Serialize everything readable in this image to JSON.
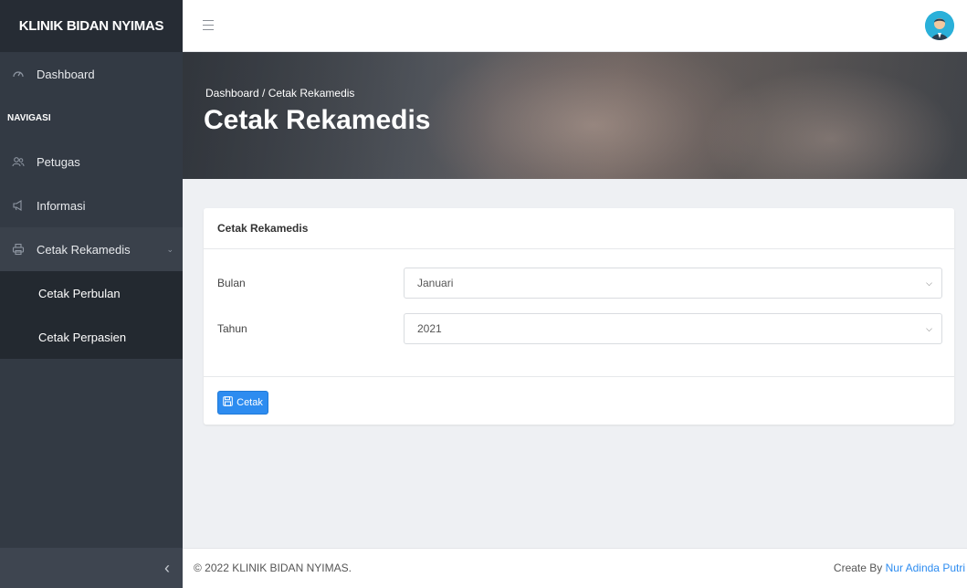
{
  "brand": "KLINIK BIDAN NYIMAS",
  "sidebar": {
    "items": [
      {
        "label": "Dashboard",
        "icon": "dashboard-icon"
      },
      {
        "section": "NAVIGASI"
      },
      {
        "label": "Petugas",
        "icon": "users-icon"
      },
      {
        "label": "Informasi",
        "icon": "megaphone-icon"
      },
      {
        "label": "Cetak Rekamedis",
        "icon": "printer-icon",
        "expanded": true
      }
    ],
    "subitems": [
      "Cetak Perbulan",
      "Cetak Perpasien"
    ]
  },
  "header": {
    "breadcrumb": "Dashboard / Cetak Rekamedis",
    "title": "Cetak Rekamedis"
  },
  "card": {
    "title": "Cetak Rekamedis",
    "fields": [
      {
        "label": "Bulan",
        "value": "Januari"
      },
      {
        "label": "Tahun",
        "value": "2021"
      }
    ],
    "button_label": "Cetak"
  },
  "footer": {
    "copyright": "© 2022 KLINIK BIDAN NYIMAS.",
    "credit_prefix": "Create By",
    "author": "Nur Adinda Putri"
  },
  "colors": {
    "sidebar_bg": "#333a44",
    "brand_bg": "#262c34",
    "accent": "#2d8cf0"
  }
}
